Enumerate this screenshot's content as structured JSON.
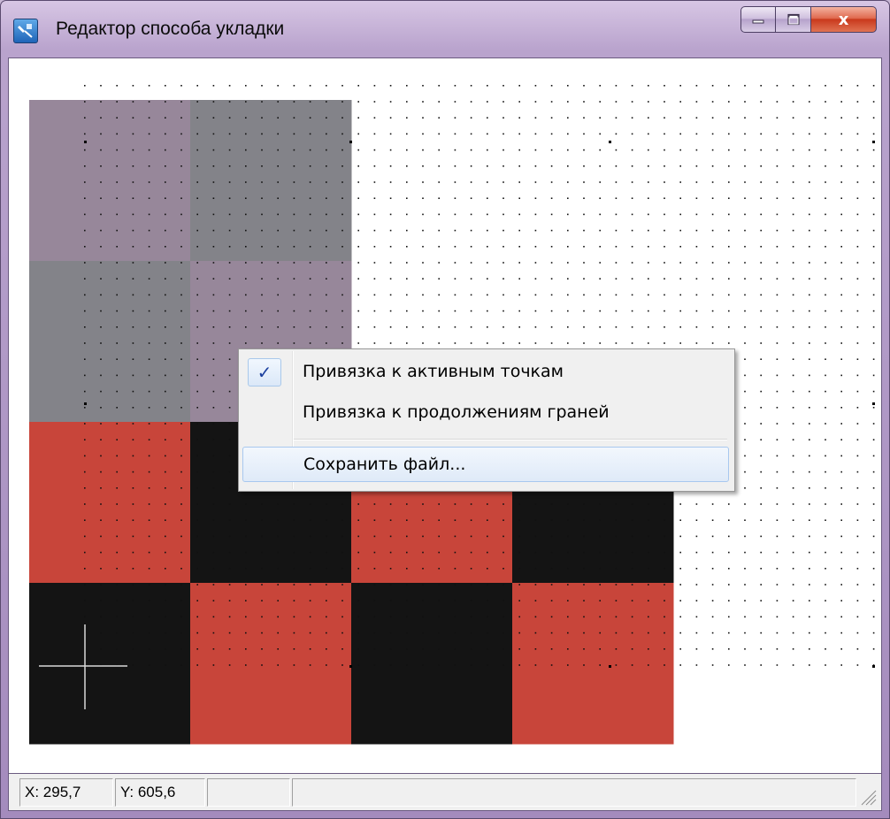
{
  "window": {
    "title": "Редактор способа укладки",
    "icon": "pattern-editor-icon",
    "caption_buttons": {
      "minimize": "minimize-icon",
      "maximize": "maximize-icon",
      "close": "x"
    }
  },
  "canvas": {
    "grid": "dotted",
    "tile_colors": {
      "mauve": "#97879a",
      "gray": "#838389",
      "red": "#c8453a",
      "black": "#141414"
    },
    "tile_rows": [
      [
        "mauve",
        "gray"
      ],
      [
        "gray",
        "mauve"
      ],
      [
        "red",
        "black",
        "red",
        "black"
      ],
      [
        "black",
        "red",
        "black",
        "red"
      ]
    ],
    "cursor": "crosshair-icon"
  },
  "context_menu": {
    "items": [
      {
        "label": "Привязка к активным точкам",
        "checked": true
      },
      {
        "label": "Привязка к продолжениям граней",
        "checked": false
      },
      {
        "label": "Сохранить файл...",
        "checked": false,
        "highlighted": true
      }
    ],
    "check_glyph": "✓"
  },
  "statusbar": {
    "x": "X: 295,7",
    "y": "Y: 605,6",
    "pane3": "",
    "pane4": ""
  }
}
